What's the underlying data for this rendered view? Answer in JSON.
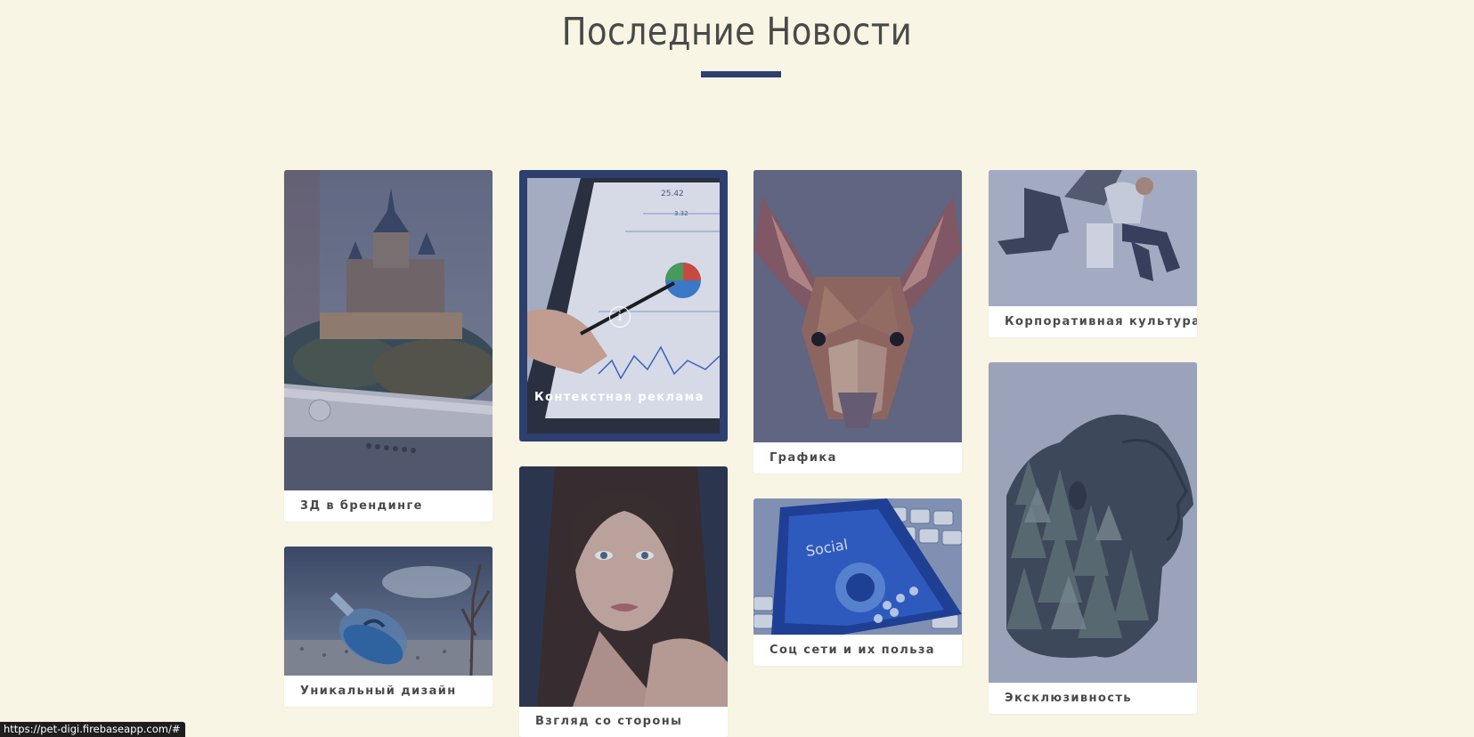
{
  "section": {
    "title": "Последние Новости",
    "accent_color": "#2d3f6f",
    "background_color": "#f8f5e4"
  },
  "cards": [
    {
      "id": "3d-branding",
      "title": "3Д в брендинге",
      "image": "castle-on-phone-image"
    },
    {
      "id": "unique-design",
      "title": "Уникальный дизайн",
      "image": "bottle-with-dolphin-image"
    },
    {
      "id": "context-ads",
      "title": "Контекстная реклама",
      "image": "tablet-analytics-image",
      "active": true,
      "icon": "info-icon"
    },
    {
      "id": "outside-view",
      "title": "Взгляд со стороны",
      "image": "woman-portrait-image"
    },
    {
      "id": "graphics",
      "title": "Графика",
      "image": "low-poly-deer-image"
    },
    {
      "id": "social-media",
      "title": "Соц сети и их польза",
      "image": "social-phone-keyboard-image"
    },
    {
      "id": "corporate-culture",
      "title": "Корпоративная культура",
      "image": "office-people-image"
    },
    {
      "id": "exclusivity",
      "title": "Эксклюзивность",
      "image": "forest-profile-image"
    }
  ],
  "status_bar": {
    "url": "https://pet-digi.firebaseapp.com/#"
  }
}
